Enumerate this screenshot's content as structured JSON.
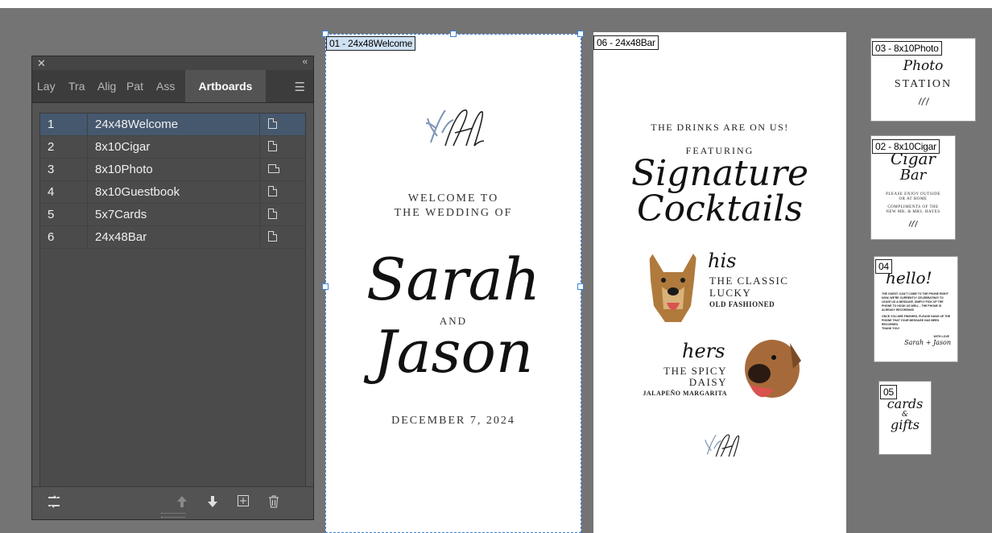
{
  "panel": {
    "close_icon": "close-icon",
    "collapse_icon": "double-chevron-icon",
    "tabs": [
      {
        "label": "Lay"
      },
      {
        "label": "Tra"
      },
      {
        "label": "Alig"
      },
      {
        "label": "Pat"
      },
      {
        "label": "Ass"
      },
      {
        "label": "Artboards"
      }
    ],
    "menu_icon": "hamburger-icon",
    "artboards": [
      {
        "num": "1",
        "name": "24x48Welcome",
        "orientation": "portrait",
        "selected": true
      },
      {
        "num": "2",
        "name": "8x10Cigar",
        "orientation": "portrait"
      },
      {
        "num": "3",
        "name": "8x10Photo",
        "orientation": "landscape"
      },
      {
        "num": "4",
        "name": "8x10Guestbook",
        "orientation": "portrait"
      },
      {
        "num": "5",
        "name": "5x7Cards",
        "orientation": "portrait"
      },
      {
        "num": "6",
        "name": "24x48Bar",
        "orientation": "portrait"
      }
    ],
    "bottom_icons": [
      "rearrange-icon",
      "move-up-icon",
      "move-down-icon",
      "new-artboard-icon",
      "delete-icon"
    ]
  },
  "boards": {
    "b1": {
      "label": "01 - 24x48Welcome",
      "welcome_line1": "WELCOME TO",
      "welcome_line2": "THE WEDDING OF",
      "name1": "Sarah",
      "and": "AND",
      "name2": "Jason",
      "date": "DECEMBER 7, 2024"
    },
    "b6": {
      "label": "06 - 24x48Bar",
      "line1": "THE DRINKS ARE ON US!",
      "featuring": "FEATURING",
      "script1": "Signature",
      "script2": "Cocktails",
      "his": "his",
      "drink1_line1": "THE CLASSIC",
      "drink1_line2": "LUCKY",
      "drink1_sub": "OLD FASHIONED",
      "hers": "hers",
      "drink2_line1": "THE SPICY",
      "drink2_line2": "DAISY",
      "drink2_sub": "JALAPEÑO MARGARITA"
    },
    "b3": {
      "label": "03 - 8x10Photo",
      "script": "Photo",
      "title": "STATION"
    },
    "b2": {
      "label": "02 - 8x10Cigar",
      "script1": "Cigar",
      "script2": "Bar",
      "line1": "PLEASE ENJOY OUTSIDE",
      "line2": "OR AT HOME",
      "line3": "COMPLIMENTS OF THE",
      "line4": "NEW MR. & MRS. HAYES"
    },
    "b4": {
      "label": "04",
      "script": "hello!",
      "para1": "THE GUEST: CAN'T COME TO THE PHONE RIGHT NOW, WE'RE CURRENTLY CELEBRATING! TO LEAVE US A MESSAGE, SIMPLY PICK UP THE PHONE TO HOOK US WELL - THE PHONE IS ALREADY RECORDING!",
      "para2": "ONCE YOU ARE FINISHED, PLEASE HANG UP THE PHONE THAT YOUR MESSAGE HAS BEEN RECORDED.",
      "thanks": "THANK YOU!",
      "withlove": "WITH LOVE",
      "sig": "Sarah + Jason"
    },
    "b5": {
      "label": "05",
      "script1": "cards",
      "amp": "&",
      "script2": "gifts"
    }
  }
}
